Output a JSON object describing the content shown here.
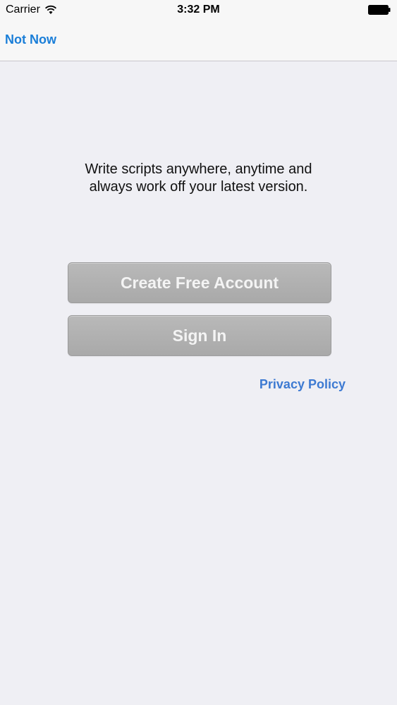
{
  "status_bar": {
    "carrier": "Carrier",
    "time": "3:32 PM",
    "wifi_icon": "wifi-icon",
    "battery_icon": "battery-icon"
  },
  "nav": {
    "not_now_label": "Not Now"
  },
  "main": {
    "tagline_line1": "Write scripts anywhere, anytime and",
    "tagline_line2": "always work off your latest version.",
    "create_account_label": "Create Free Account",
    "sign_in_label": "Sign In",
    "privacy_policy_label": "Privacy Policy"
  },
  "colors": {
    "background": "#efeff4",
    "nav_background": "#f7f7f7",
    "link_blue": "#1a7ed8",
    "privacy_blue": "#3d7ad2",
    "button_gray": "#b1b1b1",
    "button_text": "#f4f4f4"
  }
}
